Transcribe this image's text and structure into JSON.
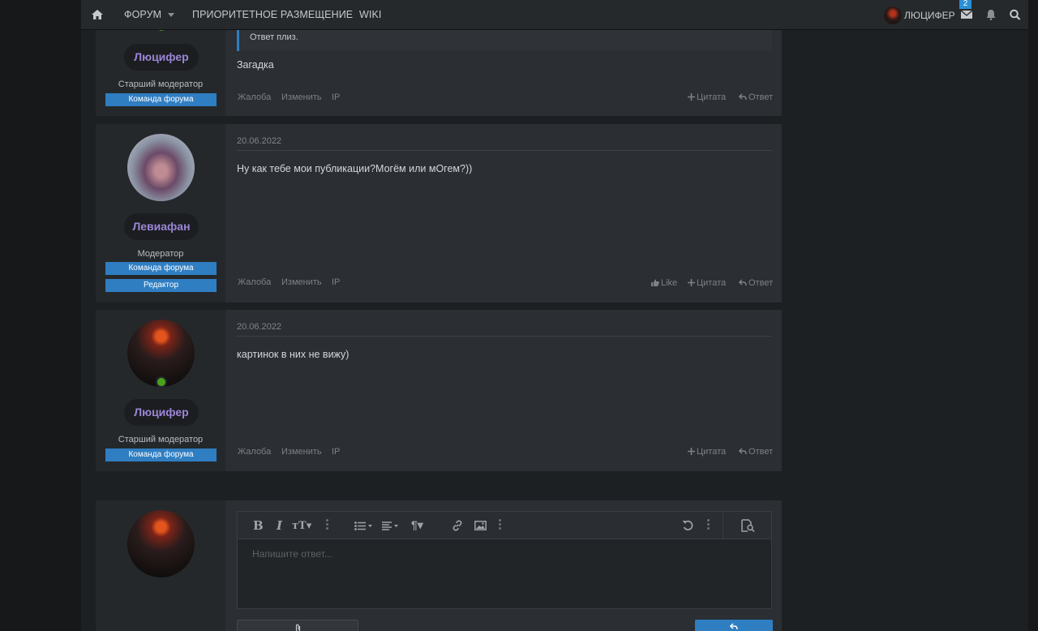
{
  "nav": {
    "forum": "ФОРУМ",
    "priority": "ПРИОРИТЕТНОЕ РАЗМЕЩЕНИЕ",
    "wiki": "WIKI",
    "user": "ЛЮЦИФЕР",
    "messages_badge": "2"
  },
  "post1": {
    "quote": "Ответ плиз.",
    "message": "Загадка",
    "author": "Люцифер",
    "role": "Старший модератор",
    "banner": "Команда форума"
  },
  "post2": {
    "date": "20.06.2022",
    "message": "Ну как тебе мои публикации?Могём или мОгем?))",
    "author": "Левиафан",
    "role": "Модератор",
    "banner1": "Команда форума",
    "banner2": "Редактор"
  },
  "post3": {
    "date": "20.06.2022",
    "message": "картинок в них не вижу)",
    "author": "Люцифер",
    "role": "Старший модератор",
    "banner": "Команда форума"
  },
  "actions": {
    "report": "Жалоба",
    "edit": "Изменить",
    "ip": "IP",
    "like": "Like",
    "quote": "Цитата",
    "reply": "Ответ"
  },
  "editor": {
    "placeholder": "Напишите ответ..."
  },
  "colors": {
    "accent": "#2f7ec2",
    "username": "#9c86d6"
  }
}
